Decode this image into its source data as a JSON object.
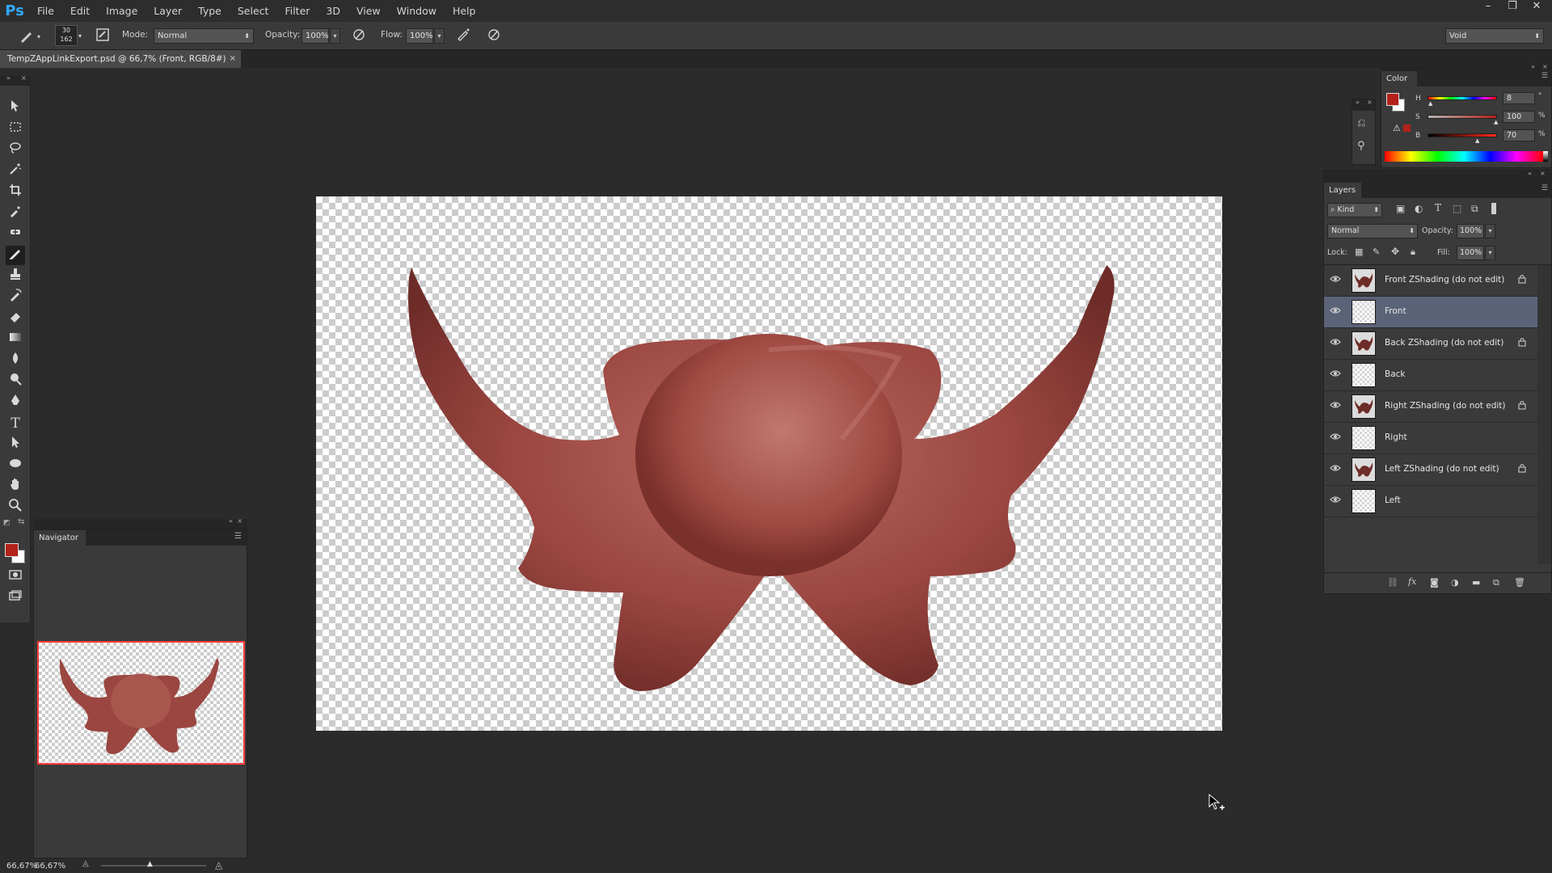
{
  "app": {
    "logo": "Ps"
  },
  "menu": [
    "File",
    "Edit",
    "Image",
    "Layer",
    "Type",
    "Select",
    "Filter",
    "3D",
    "View",
    "Window",
    "Help"
  ],
  "window_controls": {
    "minimize": "–",
    "restore": "❐",
    "close": "✕"
  },
  "options_bar": {
    "brush_size": "30",
    "brush_size_sub": "162",
    "mode_label": "Mode:",
    "mode_value": "Normal",
    "opacity_label": "Opacity:",
    "opacity_value": "100%",
    "flow_label": "Flow:",
    "flow_value": "100%",
    "workspace": "Void"
  },
  "document": {
    "tab_title": "TempZAppLinkExport.psd @ 66,7% (Front, RGB/8#)",
    "close": "×"
  },
  "navigator": {
    "title": "Navigator",
    "zoom": "66,67%"
  },
  "statusbar": {
    "zoom": "66,67%"
  },
  "color_panel": {
    "title": "Color",
    "h_label": "H",
    "h_value": "8",
    "h_unit": "°",
    "s_label": "S",
    "s_value": "100",
    "s_unit": "%",
    "b_label": "B",
    "b_value": "70",
    "b_unit": "%",
    "fg_color": "#b32118"
  },
  "layers_panel": {
    "title": "Layers",
    "filter_kind": "Kind",
    "blend_mode": "Normal",
    "opacity_label": "Opacity:",
    "opacity_value": "100%",
    "lock_label": "Lock:",
    "fill_label": "Fill:",
    "fill_value": "100%",
    "layers": [
      {
        "name": "Front ZShading (do not edit)",
        "locked": true,
        "selected": false,
        "shaded": true
      },
      {
        "name": "Front",
        "locked": false,
        "selected": true,
        "shaded": false
      },
      {
        "name": "Back ZShading (do not edit)",
        "locked": true,
        "selected": false,
        "shaded": true
      },
      {
        "name": "Back",
        "locked": false,
        "selected": false,
        "shaded": false
      },
      {
        "name": "Right ZShading (do not edit)",
        "locked": true,
        "selected": false,
        "shaded": true
      },
      {
        "name": "Right",
        "locked": false,
        "selected": false,
        "shaded": false
      },
      {
        "name": "Left ZShading (do not edit)",
        "locked": true,
        "selected": false,
        "shaded": true
      },
      {
        "name": "Left",
        "locked": false,
        "selected": false,
        "shaded": false
      }
    ]
  },
  "colors": {
    "model": "#a4504a",
    "model_dark": "#6e2c28",
    "accent_selected": "#5b6378"
  }
}
